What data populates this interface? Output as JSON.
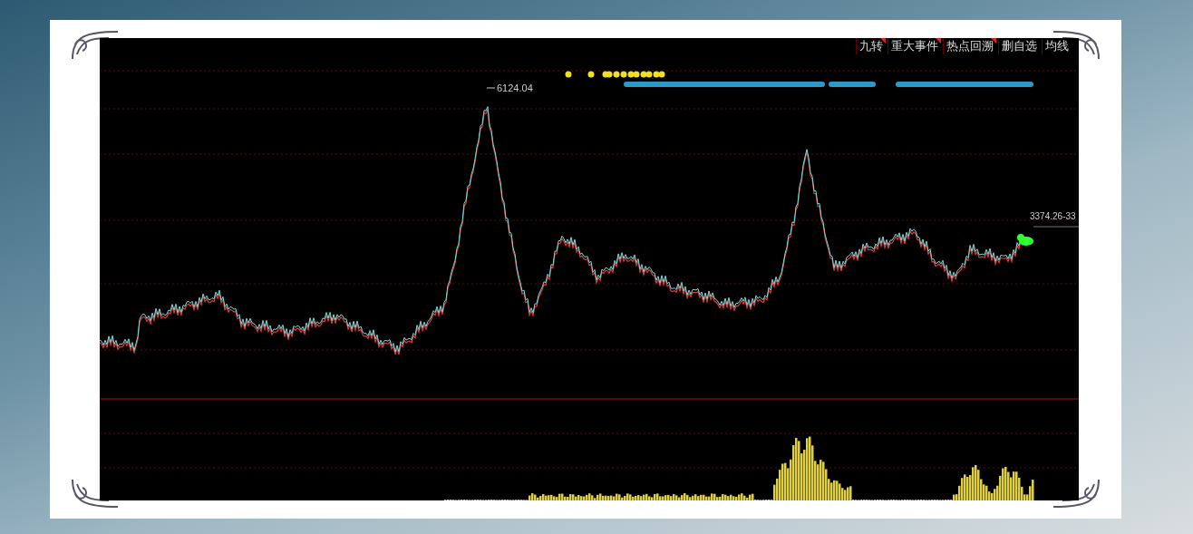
{
  "toolbar": {
    "tabs": [
      {
        "label": "九转",
        "flagged": true
      },
      {
        "label": "重大事件",
        "flagged": true
      },
      {
        "label": "热点回溯",
        "flagged": true
      },
      {
        "label": "删自选",
        "flagged": false
      },
      {
        "label": "均线",
        "flagged": false
      }
    ]
  },
  "chart": {
    "peak_label": "6124.04",
    "last_price_label": "3374.26-33"
  }
}
